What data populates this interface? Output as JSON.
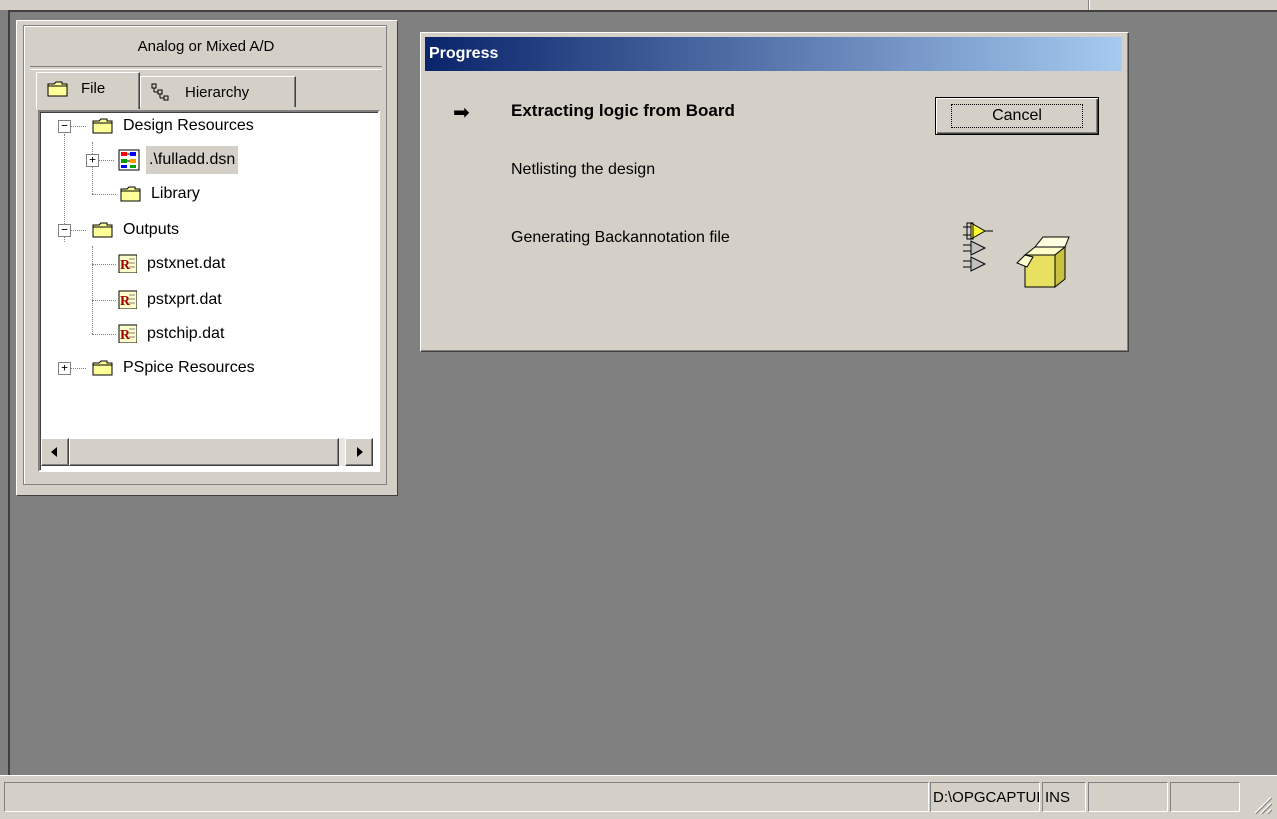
{
  "project": {
    "title": "Analog or Mixed A/D",
    "tabs": [
      {
        "label": "File",
        "icon": "folder-icon"
      },
      {
        "label": "Hierarchy",
        "icon": "hierarchy-icon"
      }
    ],
    "tree": {
      "design_resources": "Design Resources",
      "design_file": ".\\fulladd.dsn",
      "library": "Library",
      "outputs": "Outputs",
      "output_files": [
        "pstxnet.dat",
        "pstxprt.dat",
        "pstchip.dat"
      ],
      "pspice_resources": "PSpice Resources"
    }
  },
  "progress_dialog": {
    "title": "Progress",
    "steps": [
      {
        "label": "Extracting logic from Board",
        "active": true
      },
      {
        "label": "Netlisting the design",
        "active": false
      },
      {
        "label": "Generating Backannotation file",
        "active": false
      }
    ],
    "cancel_label": "Cancel"
  },
  "statusbar": {
    "message": "",
    "path": "D:\\OPGCAPTUREC",
    "mode": "INS",
    "pane3": "",
    "pane4": ""
  },
  "colors": {
    "face": "#d4d0c8",
    "workspace": "#808080",
    "title_start": "#0a246a",
    "title_end": "#a6caf0",
    "folder": "#ffff99"
  }
}
